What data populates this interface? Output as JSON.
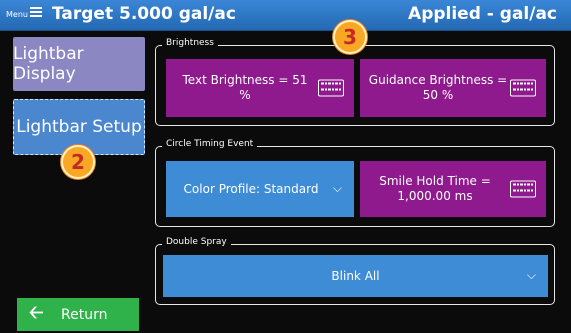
{
  "header": {
    "menu_label": "Menu",
    "target": "Target 5.000 gal/ac",
    "applied": "Applied - gal/ac"
  },
  "sidebar": {
    "lightbar_display": "Lightbar Display",
    "lightbar_setup": "Lightbar Setup",
    "return": "Return"
  },
  "markers": {
    "two": "2",
    "three": "3"
  },
  "brightness": {
    "legend": "Brightness",
    "text_brightness": "Text Brightness = 51 %",
    "guidance_brightness": "Guidance Brightness = 50 %"
  },
  "circle_timing": {
    "legend": "Circle Timing Event",
    "color_profile": "Color Profile: Standard",
    "smile_hold": "Smile Hold Time = 1,000.00 ms"
  },
  "double_spray": {
    "legend": "Double Spray",
    "value": "Blink All"
  },
  "colors": {
    "header_blue": "#2f79c8",
    "purple": "#8e1a8e",
    "blue_button": "#3e8bd6",
    "return_green": "#2fb24a",
    "marker_orange": "#f9a825"
  }
}
